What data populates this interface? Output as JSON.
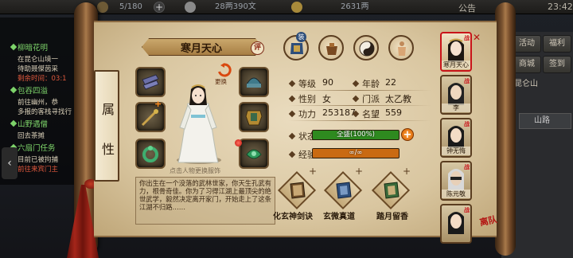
{
  "top_bar": {
    "resource1": "5/180",
    "resource2": "28两390文",
    "resource3": "2631两",
    "notice": "公告",
    "time": "23:42"
  },
  "quests": [
    {
      "title": "柳暗花明",
      "lines": [
        "在昆仑山境一",
        "待助聂傑茵采"
      ]
    },
    {
      "title": "",
      "lines": [
        "剩余时间：03:1"
      ],
      "red": true
    },
    {
      "title": "包吞四溢",
      "lines": [
        "前往幽州，恭",
        "多报的客栈寻找行"
      ]
    },
    {
      "title": "山野遇僧",
      "lines": [
        "回去茶摊"
      ]
    },
    {
      "title": "六扇门任务",
      "lines": [
        "目前已被拘捕",
        "前往来宾门主"
      ]
    }
  ],
  "right_panel": {
    "buttons": [
      "活动",
      "福利",
      "商城",
      "签到"
    ],
    "location": "昆仑山",
    "road_tab": "山路"
  },
  "attr_tab": [
    "属",
    "性"
  ],
  "character": {
    "name": "寒月天心",
    "rate_badge": "评",
    "swap_label": "更换",
    "hint": "点击人物更换服饰",
    "bio": "你出生在一个没落的武林世家，你天生孔武有力，根骨奇佳。你为了习得江湖上最顶尖的绝世武学，毅然决定离开家门，开始走上了这条江湖不归路……"
  },
  "equipment_tag": "装",
  "stats": {
    "level_label": "等级",
    "level": "90",
    "age_label": "年龄",
    "age": "22",
    "gender_label": "性别",
    "gender": "女",
    "sect_label": "门派",
    "sect": "太乙教",
    "power_label": "功力",
    "power": "253187",
    "fame_label": "名望",
    "fame": "559",
    "state_label": "状态",
    "state_text": "全盛(100%)",
    "state_pct": 1.0,
    "exp_label": "经验",
    "exp_text": "∞/∞",
    "exp_pct": 1.0
  },
  "skills": [
    {
      "name": "化玄神剑诀"
    },
    {
      "name": "玄微真道"
    },
    {
      "name": "踏月留香"
    }
  ],
  "roster": [
    {
      "name": "寒月天心",
      "selected": true,
      "tag": "战"
    },
    {
      "name": "李",
      "selected": false,
      "tag": "战"
    },
    {
      "name": "钟无悔",
      "selected": false,
      "tag": "战"
    },
    {
      "name": "陈元敬",
      "selected": false,
      "tag": "战"
    },
    {
      "name": "",
      "selected": false,
      "tag": "战"
    }
  ],
  "seal_text": "离队",
  "colors": {
    "state_bar": "#2e8a1f",
    "exp_bar": "#c96a12",
    "accent_red": "#c9141a",
    "paper": "#e3d3b0"
  }
}
